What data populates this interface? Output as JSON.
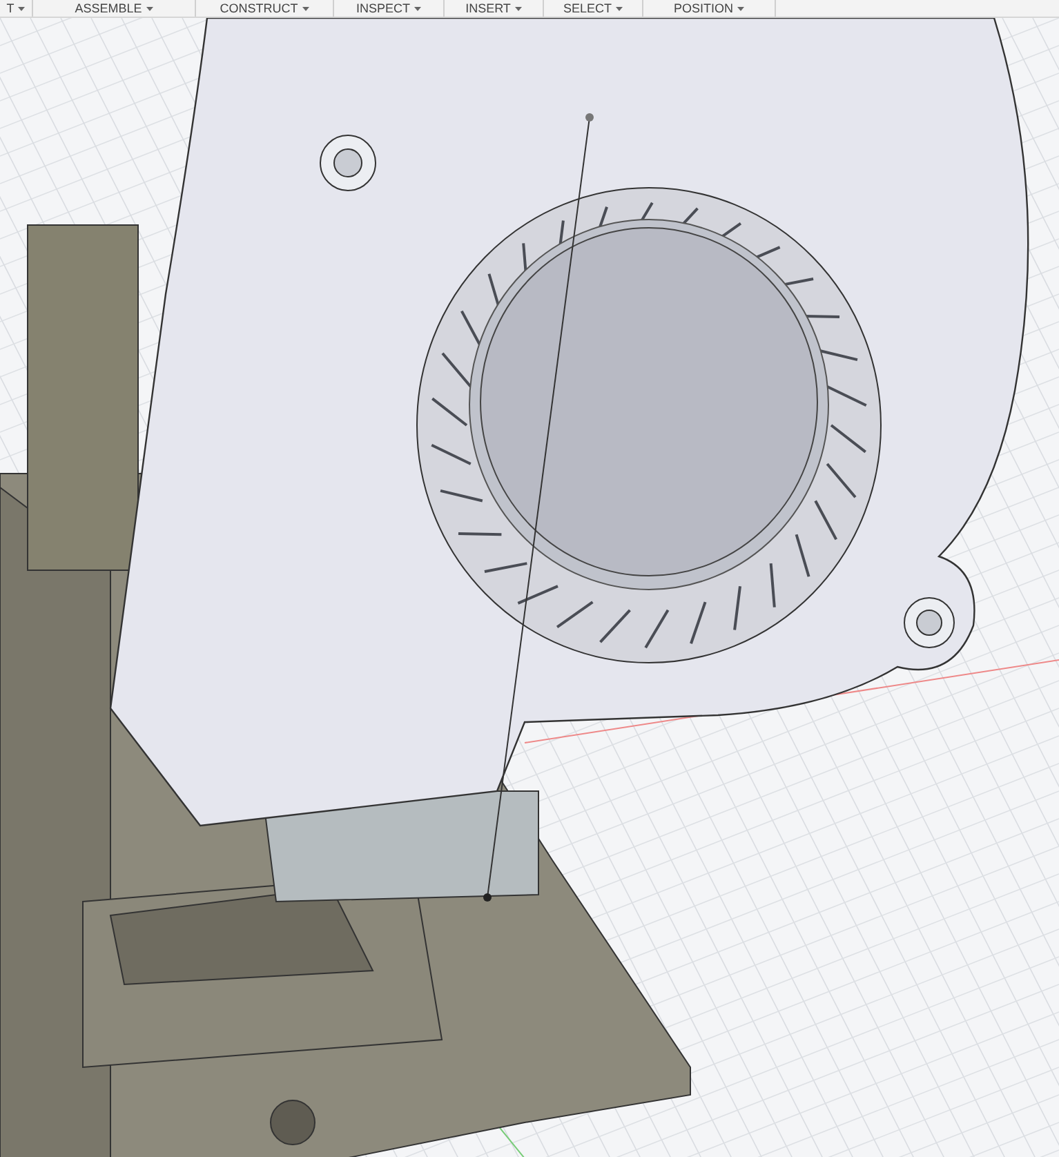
{
  "toolbar": {
    "menus": [
      {
        "label": "T"
      },
      {
        "label": "ASSEMBLE"
      },
      {
        "label": "CONSTRUCT"
      },
      {
        "label": "INSPECT"
      },
      {
        "label": "INSERT"
      },
      {
        "label": "SELECT"
      },
      {
        "label": "POSITION"
      }
    ]
  }
}
